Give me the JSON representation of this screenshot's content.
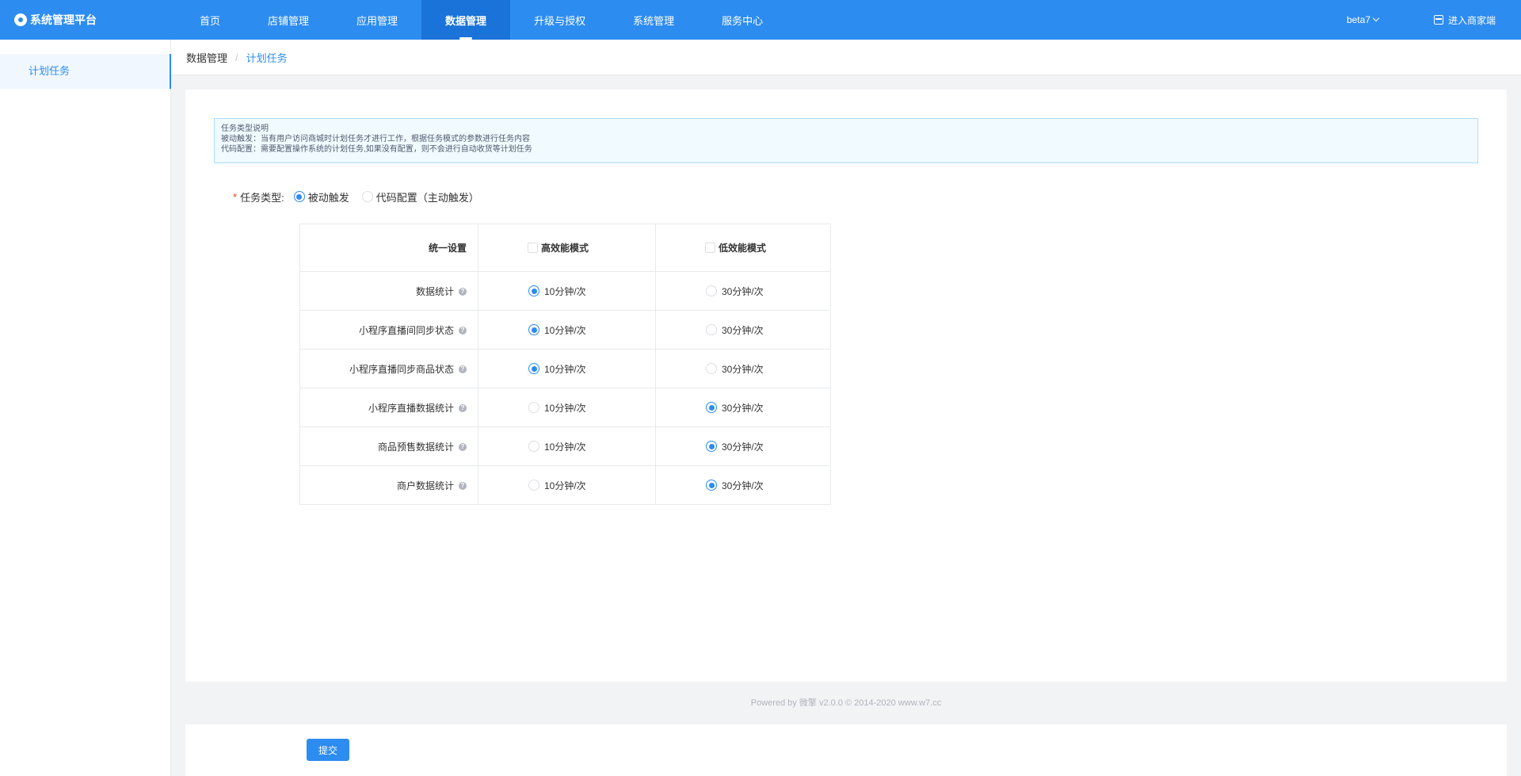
{
  "app": {
    "title": "系统管理平台"
  },
  "nav": {
    "items": [
      {
        "label": "首页",
        "active": false
      },
      {
        "label": "店铺管理",
        "active": false
      },
      {
        "label": "应用管理",
        "active": false
      },
      {
        "label": "数据管理",
        "active": true
      },
      {
        "label": "升级与授权",
        "active": false
      },
      {
        "label": "系统管理",
        "active": false
      },
      {
        "label": "服务中心",
        "active": false
      }
    ],
    "user": "beta7",
    "enter_store": "进入商家端"
  },
  "sidebar": {
    "items": [
      {
        "label": "计划任务",
        "active": true
      }
    ]
  },
  "breadcrumb": {
    "parent": "数据管理",
    "separator": "/",
    "current": "计划任务"
  },
  "notice": {
    "title": "任务类型说明",
    "line1": "被动触发：当有用户访问商城时计划任务才进行工作，根据任务模式的参数进行任务内容",
    "line2": "代码配置：需要配置操作系统的计划任务,如果没有配置，则不会进行自动收货等计划任务"
  },
  "form": {
    "required_mark": "*",
    "task_type_label": "任务类型:",
    "task_type_options": [
      {
        "label": "被动触发",
        "selected": true
      },
      {
        "label": "代码配置（主动触发）",
        "selected": false
      }
    ]
  },
  "table": {
    "header": {
      "col1": "统一设置",
      "col2": "高效能模式",
      "col3": "低效能模式"
    },
    "help_glyph": "?",
    "rows": [
      {
        "name": "数据统计",
        "opt1": "10分钟/次",
        "opt2": "30分钟/次",
        "selected": 1
      },
      {
        "name": "小程序直播间同步状态",
        "opt1": "10分钟/次",
        "opt2": "30分钟/次",
        "selected": 1
      },
      {
        "name": "小程序直播同步商品状态",
        "opt1": "10分钟/次",
        "opt2": "30分钟/次",
        "selected": 1
      },
      {
        "name": "小程序直播数据统计",
        "opt1": "10分钟/次",
        "opt2": "30分钟/次",
        "selected": 2
      },
      {
        "name": "商品预售数据统计",
        "opt1": "10分钟/次",
        "opt2": "30分钟/次",
        "selected": 2
      },
      {
        "name": "商户数据统计",
        "opt1": "10分钟/次",
        "opt2": "30分钟/次",
        "selected": 2
      }
    ]
  },
  "footer": {
    "text": "Powered by 微擎 v2.0.0 © 2014-2020 www.w7.cc"
  },
  "actions": {
    "submit_label": "提交"
  },
  "colors": {
    "primary": "#2d8cf0",
    "nav_active": "#1a73d9",
    "notice_bg": "#f0faff",
    "notice_border": "#abdcff"
  },
  "icons": {
    "logo": "gear-icon",
    "user_dropdown": "chevron-down-icon",
    "enter_store": "store-icon",
    "help": "help-icon"
  }
}
